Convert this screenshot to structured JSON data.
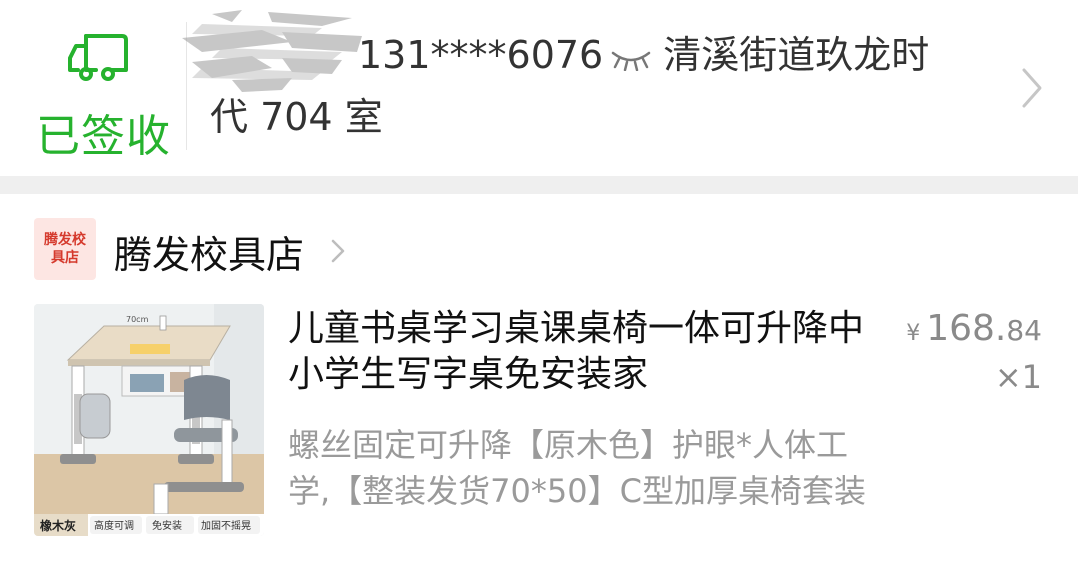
{
  "delivery": {
    "status": "已签收",
    "address_line1": "131****6076",
    "address_line1_suffix": "清溪街道玖龙时",
    "address_line2": "代 704 室",
    "icons": {
      "status": "truck-icon",
      "mask": "closed-eye-icon",
      "more": "chevron-right-icon"
    },
    "status_color": "#26b22e"
  },
  "shop": {
    "logo_line1": "腾发校",
    "logo_line2": "具店",
    "name": "腾发校具店",
    "item": {
      "title": "儿童书桌学习桌课桌椅一体可升降中小学生写字桌免安装家",
      "spec": "螺丝固定可升降【原木色】护眼*人体工学,【整装发货70*50】C型加厚桌椅套装",
      "currency": "¥",
      "price_int": "168.",
      "price_dec": "84",
      "quantity": "×1",
      "thumb_tags": [
        "橡木灰",
        "高度可调",
        "免安装",
        "加固不摇晃"
      ]
    }
  }
}
